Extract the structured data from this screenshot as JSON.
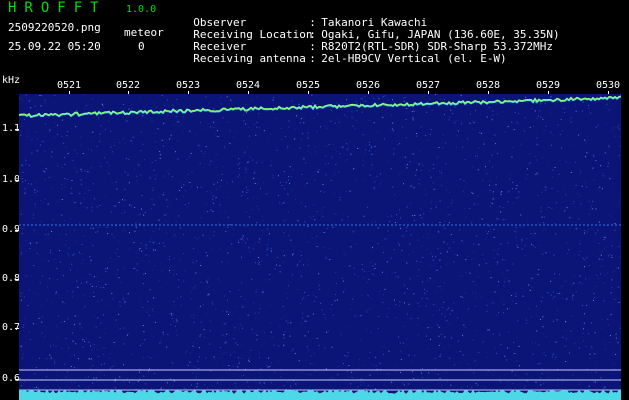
{
  "header": {
    "title": "HROFFT",
    "version": "1.0.0",
    "file_name": "2509220520.png",
    "meteor_label": "meteor",
    "timestamp": "25.09.22 05:20",
    "meteor_count": "0"
  },
  "station_info": [
    {
      "key": "Observer",
      "value": "Takanori Kawachi"
    },
    {
      "key": "Receiving Location",
      "value": "Ogaki, Gifu, JAPAN (136.60E, 35.35N)"
    },
    {
      "key": "Receiver",
      "value": "R820T2(RTL-SDR) SDR-Sharp 53.372MHz"
    },
    {
      "key": "Receiving antenna",
      "value": "2el-HB9CV Vertical (el. E-W)"
    }
  ],
  "axis": {
    "y_unit": "kHz",
    "y_ticks": [
      "1.1",
      "1.0",
      "0.9",
      "0.8",
      "0.7",
      "0.6"
    ],
    "x_ticks": [
      "0521",
      "0522",
      "0523",
      "0524",
      "0525",
      "0526",
      "0527",
      "0528",
      "0529",
      "0530"
    ]
  },
  "colors": {
    "background": "#000000",
    "waterfall_bg": "#0b1577",
    "title_green": "#00e000",
    "trace_cyan": "#4dd8e8",
    "trace_green": "#9aff60"
  }
}
